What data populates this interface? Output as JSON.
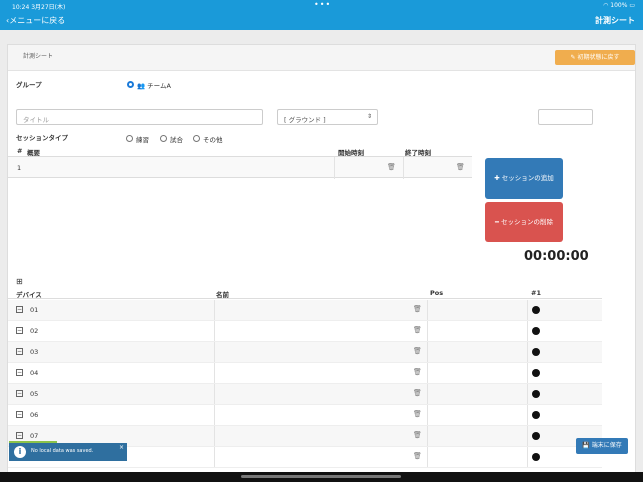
{
  "status": {
    "time": "10:24",
    "date": "3月27日(木)",
    "dots": "•••",
    "battery": "100%"
  },
  "nav": {
    "back_label": "メニューに戻る",
    "title": "計測シート"
  },
  "card": {
    "title": "計測シート",
    "reset_label": "初期状態に戻す"
  },
  "group": {
    "label": "グループ",
    "team": "チームA"
  },
  "form": {
    "title_placeholder": "タイトル",
    "ground_select": "[ グラウンド ]"
  },
  "session_type": {
    "label": "セッションタイプ",
    "options": [
      "練習",
      "試合",
      "その他"
    ]
  },
  "session_table": {
    "headers": {
      "num": "#",
      "summary": "概要",
      "start": "開始時刻",
      "end": "終了時刻"
    },
    "rows": [
      {
        "num": "1"
      }
    ]
  },
  "buttons": {
    "add_session": "セッションの追加",
    "delete_session": "セッションの削除",
    "save": "端末に保存"
  },
  "timer": "00:00:00",
  "device_table": {
    "expand": "⊞",
    "headers": {
      "device": "デバイス",
      "name": "名前",
      "pos": "Pos",
      "n1": "#1"
    },
    "rows": [
      "01",
      "02",
      "03",
      "04",
      "05",
      "06",
      "07",
      ""
    ]
  },
  "toast": {
    "message": "No local data was saved."
  }
}
